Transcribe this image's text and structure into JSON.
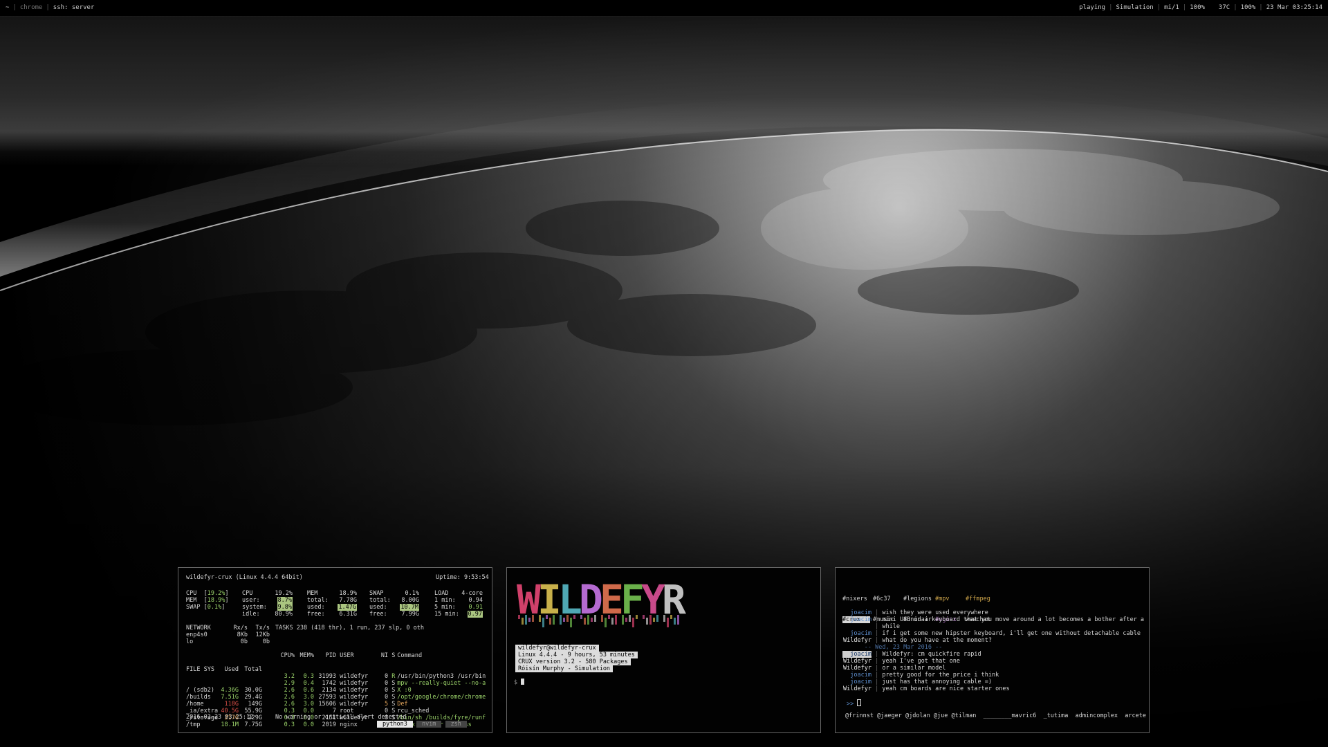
{
  "topbar": {
    "left": {
      "workspace": "~",
      "window1": "chrome",
      "window2": "ssh: server"
    },
    "right": {
      "status": "playing",
      "track": "Simulation",
      "desktop": "mi/1",
      "volume": "100%",
      "temp": "37C",
      "battery": "100%",
      "datetime": "23 Mar 03:25:14"
    }
  },
  "glances": {
    "host": "wildefyr-crux (Linux 4.4.4 64bit)",
    "uptime": "Uptime: 9:53:54",
    "bars": [
      {
        "label": "CPU  [",
        "value": "19.2%",
        "end": "]"
      },
      {
        "label": "MEM  [",
        "value": "18.9%",
        "end": "]"
      },
      {
        "label": "SWAP [",
        "value": "0.1%",
        "end": "]"
      }
    ],
    "cpu": {
      "title": "CPU",
      "total": "19.2%",
      "rows": [
        [
          "user:",
          "8.7%"
        ],
        [
          "system:",
          "9.8%"
        ],
        [
          "idle:",
          "80.9%"
        ]
      ]
    },
    "mem": {
      "title": "MEM",
      "total": "18.9%",
      "rows": [
        [
          "total:",
          "7.78G"
        ],
        [
          "used:",
          "1.47G"
        ],
        [
          "free:",
          "6.31G"
        ]
      ]
    },
    "swap": {
      "title": "SWAP",
      "total": "0.1%",
      "rows": [
        [
          "total:",
          "8.00G"
        ],
        [
          "used:",
          "10.7M"
        ],
        [
          "free:",
          "7.99G"
        ]
      ]
    },
    "load": {
      "title": "LOAD",
      "cores": "4-core",
      "rows": [
        [
          "1 min:",
          "0.94"
        ],
        [
          "5 min:",
          "0.91"
        ],
        [
          "15 min:",
          "0.97"
        ]
      ]
    },
    "network": {
      "header": [
        "NETWORK",
        "Rx/s",
        "Tx/s"
      ],
      "rows": [
        [
          "enp4s0",
          "8Kb",
          "12Kb"
        ],
        [
          "lo",
          "0b",
          "0b"
        ]
      ]
    },
    "tasks": "TASKS 238 (418 thr), 1 run, 237 slp, 0 oth",
    "proc_header": [
      "CPU%",
      "MEM%",
      "PID",
      "USER",
      "NI",
      "S",
      "Command"
    ],
    "procs": [
      [
        "3.2",
        "0.3",
        "31993",
        "wildefyr",
        "0",
        "R",
        "/usr/bin/python3 /usr/bin"
      ],
      [
        "2.9",
        "0.4",
        "1742",
        "wildefyr",
        "0",
        "S",
        "mpv --really-quiet --no-a"
      ],
      [
        "2.6",
        "0.6",
        "2134",
        "wildefyr",
        "0",
        "S",
        "X :0"
      ],
      [
        "2.6",
        "3.0",
        "27593",
        "wildefyr",
        "0",
        "S",
        "/opt/google/chrome/chrome"
      ],
      [
        "2.6",
        "3.0",
        "15606",
        "wildefyr",
        "5",
        "S",
        "Def"
      ],
      [
        "0.3",
        "0.0",
        "7",
        "root",
        "0",
        "S",
        "rcu_sched"
      ],
      [
        "0.3",
        "0.0",
        "2151",
        "wildefyr",
        "0",
        "S",
        "/bin/sh /builds/fyre/runf"
      ],
      [
        "0.3",
        "0.0",
        "2019",
        "nginx",
        "0",
        "S",
        "nginx: worker process"
      ]
    ],
    "fs_header": [
      "FILE SYS",
      "Used",
      "Total"
    ],
    "fs": [
      [
        "/ (sdb2)",
        "4.36G",
        "30.0G"
      ],
      [
        "/builds",
        "7.51G",
        "29.4G"
      ],
      [
        "/home",
        "118G",
        "149G"
      ],
      [
        "_ia/extra",
        "40.5G",
        "55.9G"
      ],
      [
        "_/storage",
        "217G",
        "229G"
      ],
      [
        "/tmp",
        "18.1M",
        "7.75G"
      ]
    ],
    "footer_time": "2016-03-23 03:25:12",
    "footer_alert": "No warning or critical alert detected",
    "tabs": [
      "python3",
      "nvim",
      "zsh"
    ]
  },
  "terminal": {
    "logo": "WILDEFYR",
    "info": [
      "wildefyr@wildefyr-crux",
      "Linux 4.4.4 - 9 hours, 53 minutes",
      "CRUX version 3.2 - 580 Packages",
      "Róisín Murphy - Simulation"
    ],
    "prompt": "$"
  },
  "irc": {
    "buffers_row1": [
      "#nixers",
      "#6c37",
      "#legions",
      "#mpv",
      "#ffmpeg"
    ],
    "buffers_row2": [
      "#crux",
      "#music",
      "#unidair",
      "#nginx",
      "weechat"
    ],
    "lines": [
      {
        "nick": "joacim",
        "text": "wish they were used everywhere",
        "cls": "nick"
      },
      {
        "nick": "joacim",
        "text": "mini USB on a keyboard that you move around a lot becomes a bother after a",
        "cls": "nick"
      },
      {
        "nick": "",
        "text": "while",
        "cls": "nick"
      },
      {
        "nick": "joacim",
        "text": "if i get some new hipster keyboard, i'll get one without detachable cable",
        "cls": "nick"
      },
      {
        "nick": "Wildefyr",
        "text": "what do you have at the moment?",
        "cls": "me"
      },
      {
        "nick": "--",
        "text": "Wed, 23 Mar 2016 --",
        "cls": "date"
      },
      {
        "nick": "joacim",
        "text": "Wildefyr: cm quickfire rapid",
        "cls": "hl"
      },
      {
        "nick": "Wildefyr",
        "text": "yeah I've got that one",
        "cls": "me"
      },
      {
        "nick": "Wildefyr",
        "text": "or a similar model",
        "cls": "me"
      },
      {
        "nick": "joacim",
        "text": "pretty good for the price i think",
        "cls": "nick"
      },
      {
        "nick": "joacim",
        "text": "just has that annoying cable =)",
        "cls": "nick"
      },
      {
        "nick": "Wildefyr",
        "text": "yeah cm boards are nice starter ones",
        "cls": "me"
      }
    ],
    "input_prompt": ">>",
    "nicklist": "@frinnst @jaeger @jdolan @jue @tilman  ________mavric6  _tutima  admincomplex  arcete"
  }
}
